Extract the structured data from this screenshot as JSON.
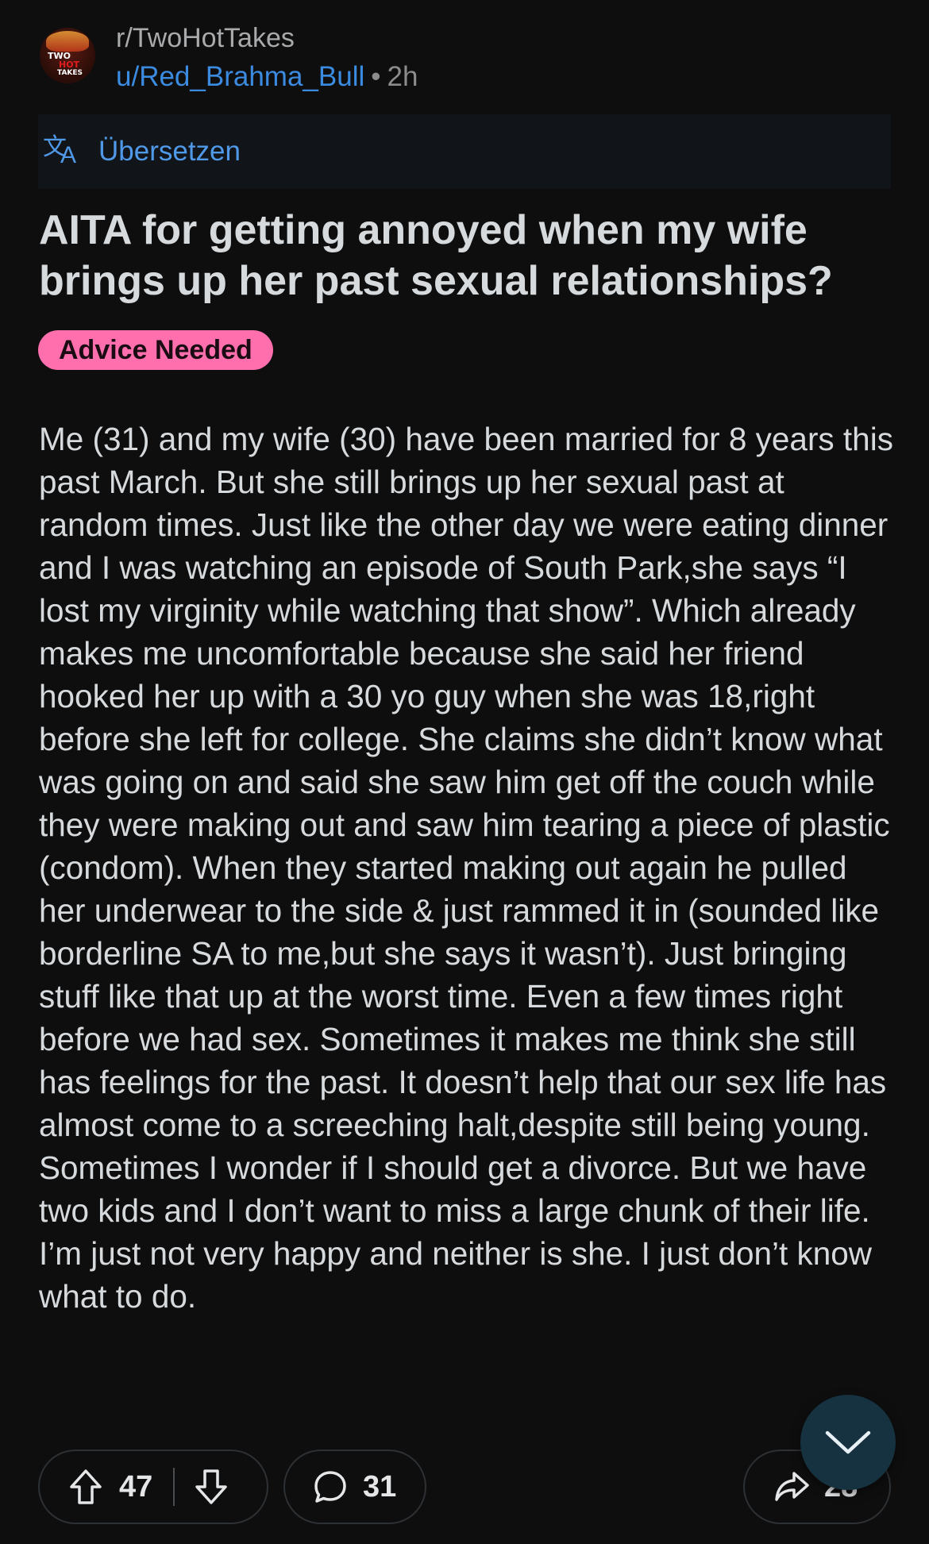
{
  "post": {
    "subreddit": "r/TwoHotTakes",
    "author": "u/Red_Brahma_Bull",
    "separator": "•",
    "age": "2h",
    "avatar_text": [
      "TWO",
      "HOT",
      "TAKES"
    ],
    "translate_label": "Übersetzen",
    "title": "AITA for getting annoyed when my wife brings up her past sexual relationships?",
    "flair": "Advice Needed",
    "body": "Me (31) and my wife (30) have been married for 8 years this past March. But she still brings up her sexual past at random times. Just like the other day we were eating dinner and I was watching an episode of South Park,she says “I lost my virginity while watching that show”. Which already makes me uncomfortable because she said her friend hooked her up with a 30 yo guy when she was 18,right before she left for college. She claims she didn’t know what was going on and said she saw him get off the couch while they were making out and saw him tearing a piece of plastic (condom). When they started making out again he pulled her underwear to the side & just rammed it in (sounded like borderline SA to me,but she says it wasn’t). Just bringing stuff like that up at the worst time. Even a few times right before we had sex. Sometimes it makes me think she still has feelings for the past. It doesn’t help that our sex life has almost come to a screeching halt,despite still being young. Sometimes I wonder if I should get a divorce. But we have two kids and I don’t want to miss a large chunk of their life. I’m just not very happy and neither is she. I just don’t know what to do."
  },
  "actions": {
    "upvotes": "47",
    "comments": "31",
    "shares": "28"
  },
  "colors": {
    "background": "#0e0e0f",
    "link_blue": "#3b8be0",
    "flair_pink": "#ff6fae",
    "fab_bg": "#16313f"
  },
  "icons": [
    "upvote-icon",
    "downvote-icon",
    "comment-icon",
    "share-icon",
    "chevron-down-icon",
    "translate-icon"
  ]
}
